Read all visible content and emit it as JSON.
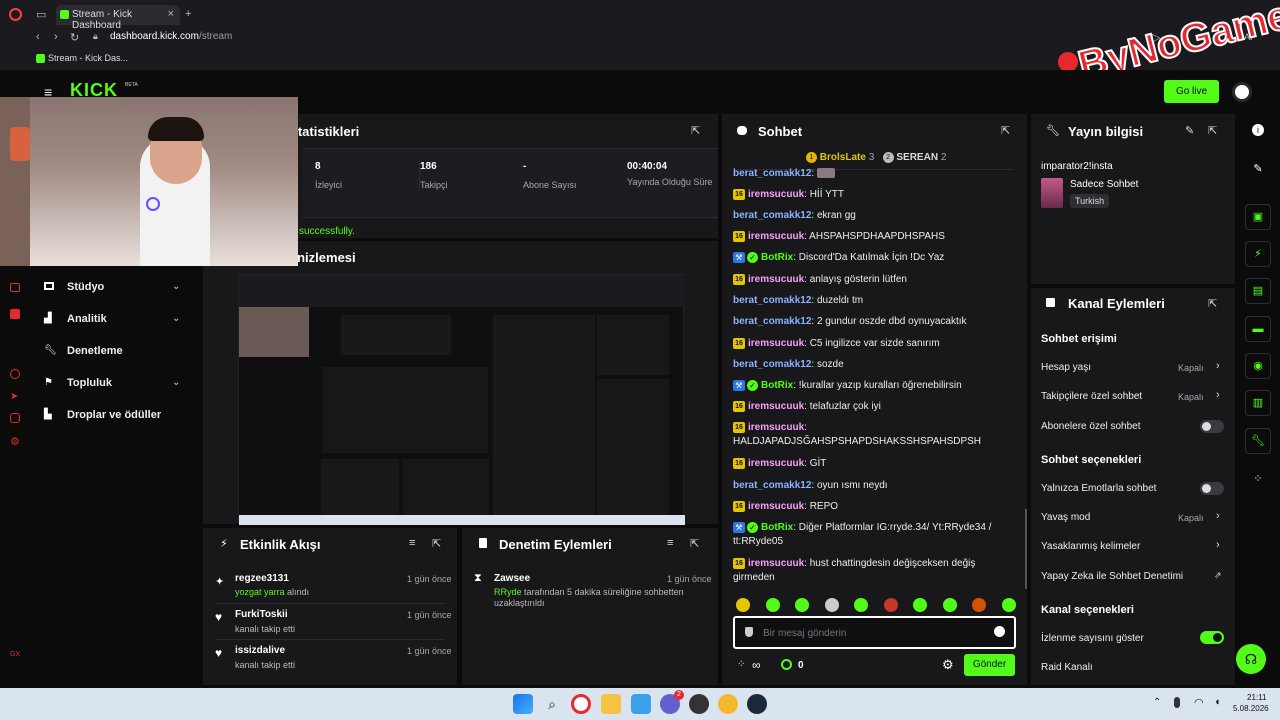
{
  "browser": {
    "tab_title": "Stream - Kick Dashboard",
    "new_tab": "+",
    "url_host": "dashboard.kick.com",
    "url_path": "/stream",
    "bookmark": "Stream - Kick Das...",
    "ai_label": "AI"
  },
  "header": {
    "logo": "KICK",
    "logo_tag": "BETA",
    "go_live": "Go live"
  },
  "watermark": "ByNoGame",
  "stats": {
    "title": "İstatistikleri",
    "items": [
      {
        "value": "8",
        "label": "İzleyici"
      },
      {
        "value": "186",
        "label": "Takipçi"
      },
      {
        "value": "-",
        "label": "Abone Sayısı"
      },
      {
        "value": "00:40:04",
        "label": "Yayında Olduğu Süre"
      }
    ],
    "success_msg": "successfully."
  },
  "preview": {
    "title": "Önizlemesi"
  },
  "sidebar": {
    "items": [
      {
        "label": "Stüdyo",
        "chevron": true
      },
      {
        "label": "Analitik",
        "chevron": true
      },
      {
        "label": "Denetleme",
        "chevron": false
      },
      {
        "label": "Topluluk",
        "chevron": true
      },
      {
        "label": "Droplar ve ödüller",
        "chevron": false
      }
    ],
    "gx": "GX"
  },
  "activity": {
    "title": "Etkinlik Akışı",
    "items": [
      {
        "user": "regzee3131",
        "time": "1 gün önce",
        "highlight": "yozgat yarra",
        "detail": " alındı"
      },
      {
        "user": "FurkiToskii",
        "time": "1 gün önce",
        "highlight": "",
        "detail": "kanalı takip etti"
      },
      {
        "user": "issizdalive",
        "time": "1 gün önce",
        "highlight": "",
        "detail": "kanalı takip etti"
      }
    ]
  },
  "moderation": {
    "title": "Denetim Eylemleri",
    "items": [
      {
        "user": "Zawsee",
        "time": "1 gün önce",
        "actor": "RRyde",
        "detail": " tarafından 5 dakika süreliğine sohbetten uzaklaştırıldı"
      }
    ]
  },
  "chat": {
    "title": "Sohbet",
    "top": [
      {
        "name": "BrolsLate",
        "count": "3"
      },
      {
        "name": "SEREAN",
        "count": "2"
      }
    ],
    "messages": [
      {
        "badge": "",
        "user": "berat_comakk12",
        "color": "blue",
        "text": ""
      },
      {
        "badge": "16",
        "user": "iremsucuuk",
        "color": "pink",
        "text": "Hİİ YTT"
      },
      {
        "badge": "",
        "user": "berat_comakk12",
        "color": "blue",
        "text": "ekran gg"
      },
      {
        "badge": "16",
        "user": "iremsucuuk",
        "color": "pink",
        "text": "AHSPAHSPDHAAPDHSPAHS"
      },
      {
        "badge": "bot",
        "user": "BotRix",
        "color": "green",
        "text": "Discord'Da Katılmak İçin !Dc Yaz"
      },
      {
        "badge": "16",
        "user": "iremsucuuk",
        "color": "pink",
        "text": "anlayış gösterin lütfen"
      },
      {
        "badge": "",
        "user": "berat_comakk12",
        "color": "blue",
        "text": "duzeldı tm"
      },
      {
        "badge": "",
        "user": "berat_comakk12",
        "color": "blue",
        "text": "2 gundur oszde dbd oynuyacaktık"
      },
      {
        "badge": "16",
        "user": "iremsucuuk",
        "color": "pink",
        "text": "C5 ingilizce var sizde sanırım"
      },
      {
        "badge": "",
        "user": "berat_comakk12",
        "color": "blue",
        "text": "sozde"
      },
      {
        "badge": "bot",
        "user": "BotRix",
        "color": "green",
        "text": "!kurallar yazıp kuralları öğrenebilirsin"
      },
      {
        "badge": "16",
        "user": "iremsucuuk",
        "color": "pink",
        "text": "telafuzlar çok iyi"
      },
      {
        "badge": "16",
        "user": "iremsucuuk",
        "color": "pink",
        "text": "HALDJAPADJSĞAHSPSHAPDSHAKSSHSPAHSDPSH"
      },
      {
        "badge": "16",
        "user": "iremsucuuk",
        "color": "pink",
        "text": "GİT"
      },
      {
        "badge": "",
        "user": "berat_comakk12",
        "color": "blue",
        "text": "oyun ısmı neydı"
      },
      {
        "badge": "16",
        "user": "iremsucuuk",
        "color": "pink",
        "text": "REPO"
      },
      {
        "badge": "bot",
        "user": "BotRix",
        "color": "green",
        "text": "Diğer Platformlar IG:rryde.34/ Yt:RRyde34 / tt:RRyde05"
      },
      {
        "badge": "16",
        "user": "iremsucuuk",
        "color": "pink",
        "text": "hust chattingdesin değişceksen değiş girmeden"
      }
    ],
    "input_placeholder": "Bir mesaj gönderin",
    "points": "0",
    "send": "Gönder"
  },
  "streaminfo": {
    "title": "Yayın bilgisi",
    "stream_title": "imparator2!insta",
    "category": "Sadece Sohbet",
    "language": "Turkish"
  },
  "channel": {
    "title": "Kanal Eylemleri",
    "sections": [
      {
        "heading": "Sohbet erişimi",
        "rows": [
          {
            "label": "Hesap yaşı",
            "kind": "select",
            "value": "Kapalı"
          },
          {
            "label": "Takipçilere özel sohbet",
            "kind": "select",
            "value": "Kapalı"
          },
          {
            "label": "Abonelere özel sohbet",
            "kind": "toggle",
            "on": false
          }
        ]
      },
      {
        "heading": "Sohbet seçenekleri",
        "rows": [
          {
            "label": "Yalnızca Emotlarla sohbet",
            "kind": "toggle",
            "on": false
          },
          {
            "label": "Yavaş mod",
            "kind": "select",
            "value": "Kapalı"
          },
          {
            "label": "Yasaklanmış kelimeler",
            "kind": "link",
            "value": ""
          },
          {
            "label": "Yapay Zeka ile Sohbet Denetimi",
            "kind": "external",
            "value": ""
          }
        ]
      },
      {
        "heading": "Kanal seçenekleri",
        "rows": [
          {
            "label": "İzlenme sayısını göster",
            "kind": "toggle",
            "on": true
          },
          {
            "label": "Raid Kanalı",
            "kind": "link",
            "value": ""
          }
        ]
      }
    ]
  },
  "taskbar": {
    "time": "21:11",
    "date": "5.08.2026",
    "chat_badge": "2"
  },
  "colors": {
    "accent": "#53fc18",
    "panel": "#18181b",
    "bg": "#0b0b0c"
  }
}
